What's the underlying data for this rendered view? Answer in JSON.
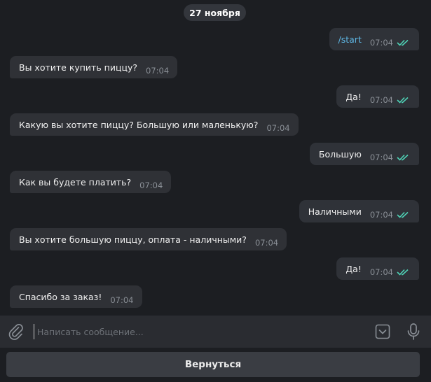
{
  "chat": {
    "date": "27 ноября",
    "messages": [
      {
        "direction": "out",
        "text": "/start",
        "time": "07:04",
        "is_command": true
      },
      {
        "direction": "in",
        "text": "Вы хотите купить пиццу?",
        "time": "07:04"
      },
      {
        "direction": "out",
        "text": "Да!",
        "time": "07:04"
      },
      {
        "direction": "in",
        "text": "Какую вы хотите пиццу? Большую или маленькую?",
        "time": "07:04"
      },
      {
        "direction": "out",
        "text": "Большую",
        "time": "07:04"
      },
      {
        "direction": "in",
        "text": "Как вы будете платить?",
        "time": "07:04"
      },
      {
        "direction": "out",
        "text": "Наличными",
        "time": "07:04"
      },
      {
        "direction": "in",
        "text": "Вы хотите большую пиццу, оплата - наличными?",
        "time": "07:04"
      },
      {
        "direction": "out",
        "text": "Да!",
        "time": "07:04"
      },
      {
        "direction": "in",
        "text": "Спасибо за заказ!",
        "time": "07:04"
      }
    ]
  },
  "composer": {
    "placeholder": "Написать сообщение...",
    "attach_icon": "paperclip-icon",
    "keyboard_icon": "bot-keyboard-icon",
    "mic_icon": "microphone-icon"
  },
  "footer": {
    "back_label": "Вернуться"
  },
  "colors": {
    "background": "#1c1e22",
    "bubble": "#2f3136",
    "read_check": "#4fd2b6",
    "command": "#5fb8e6"
  }
}
